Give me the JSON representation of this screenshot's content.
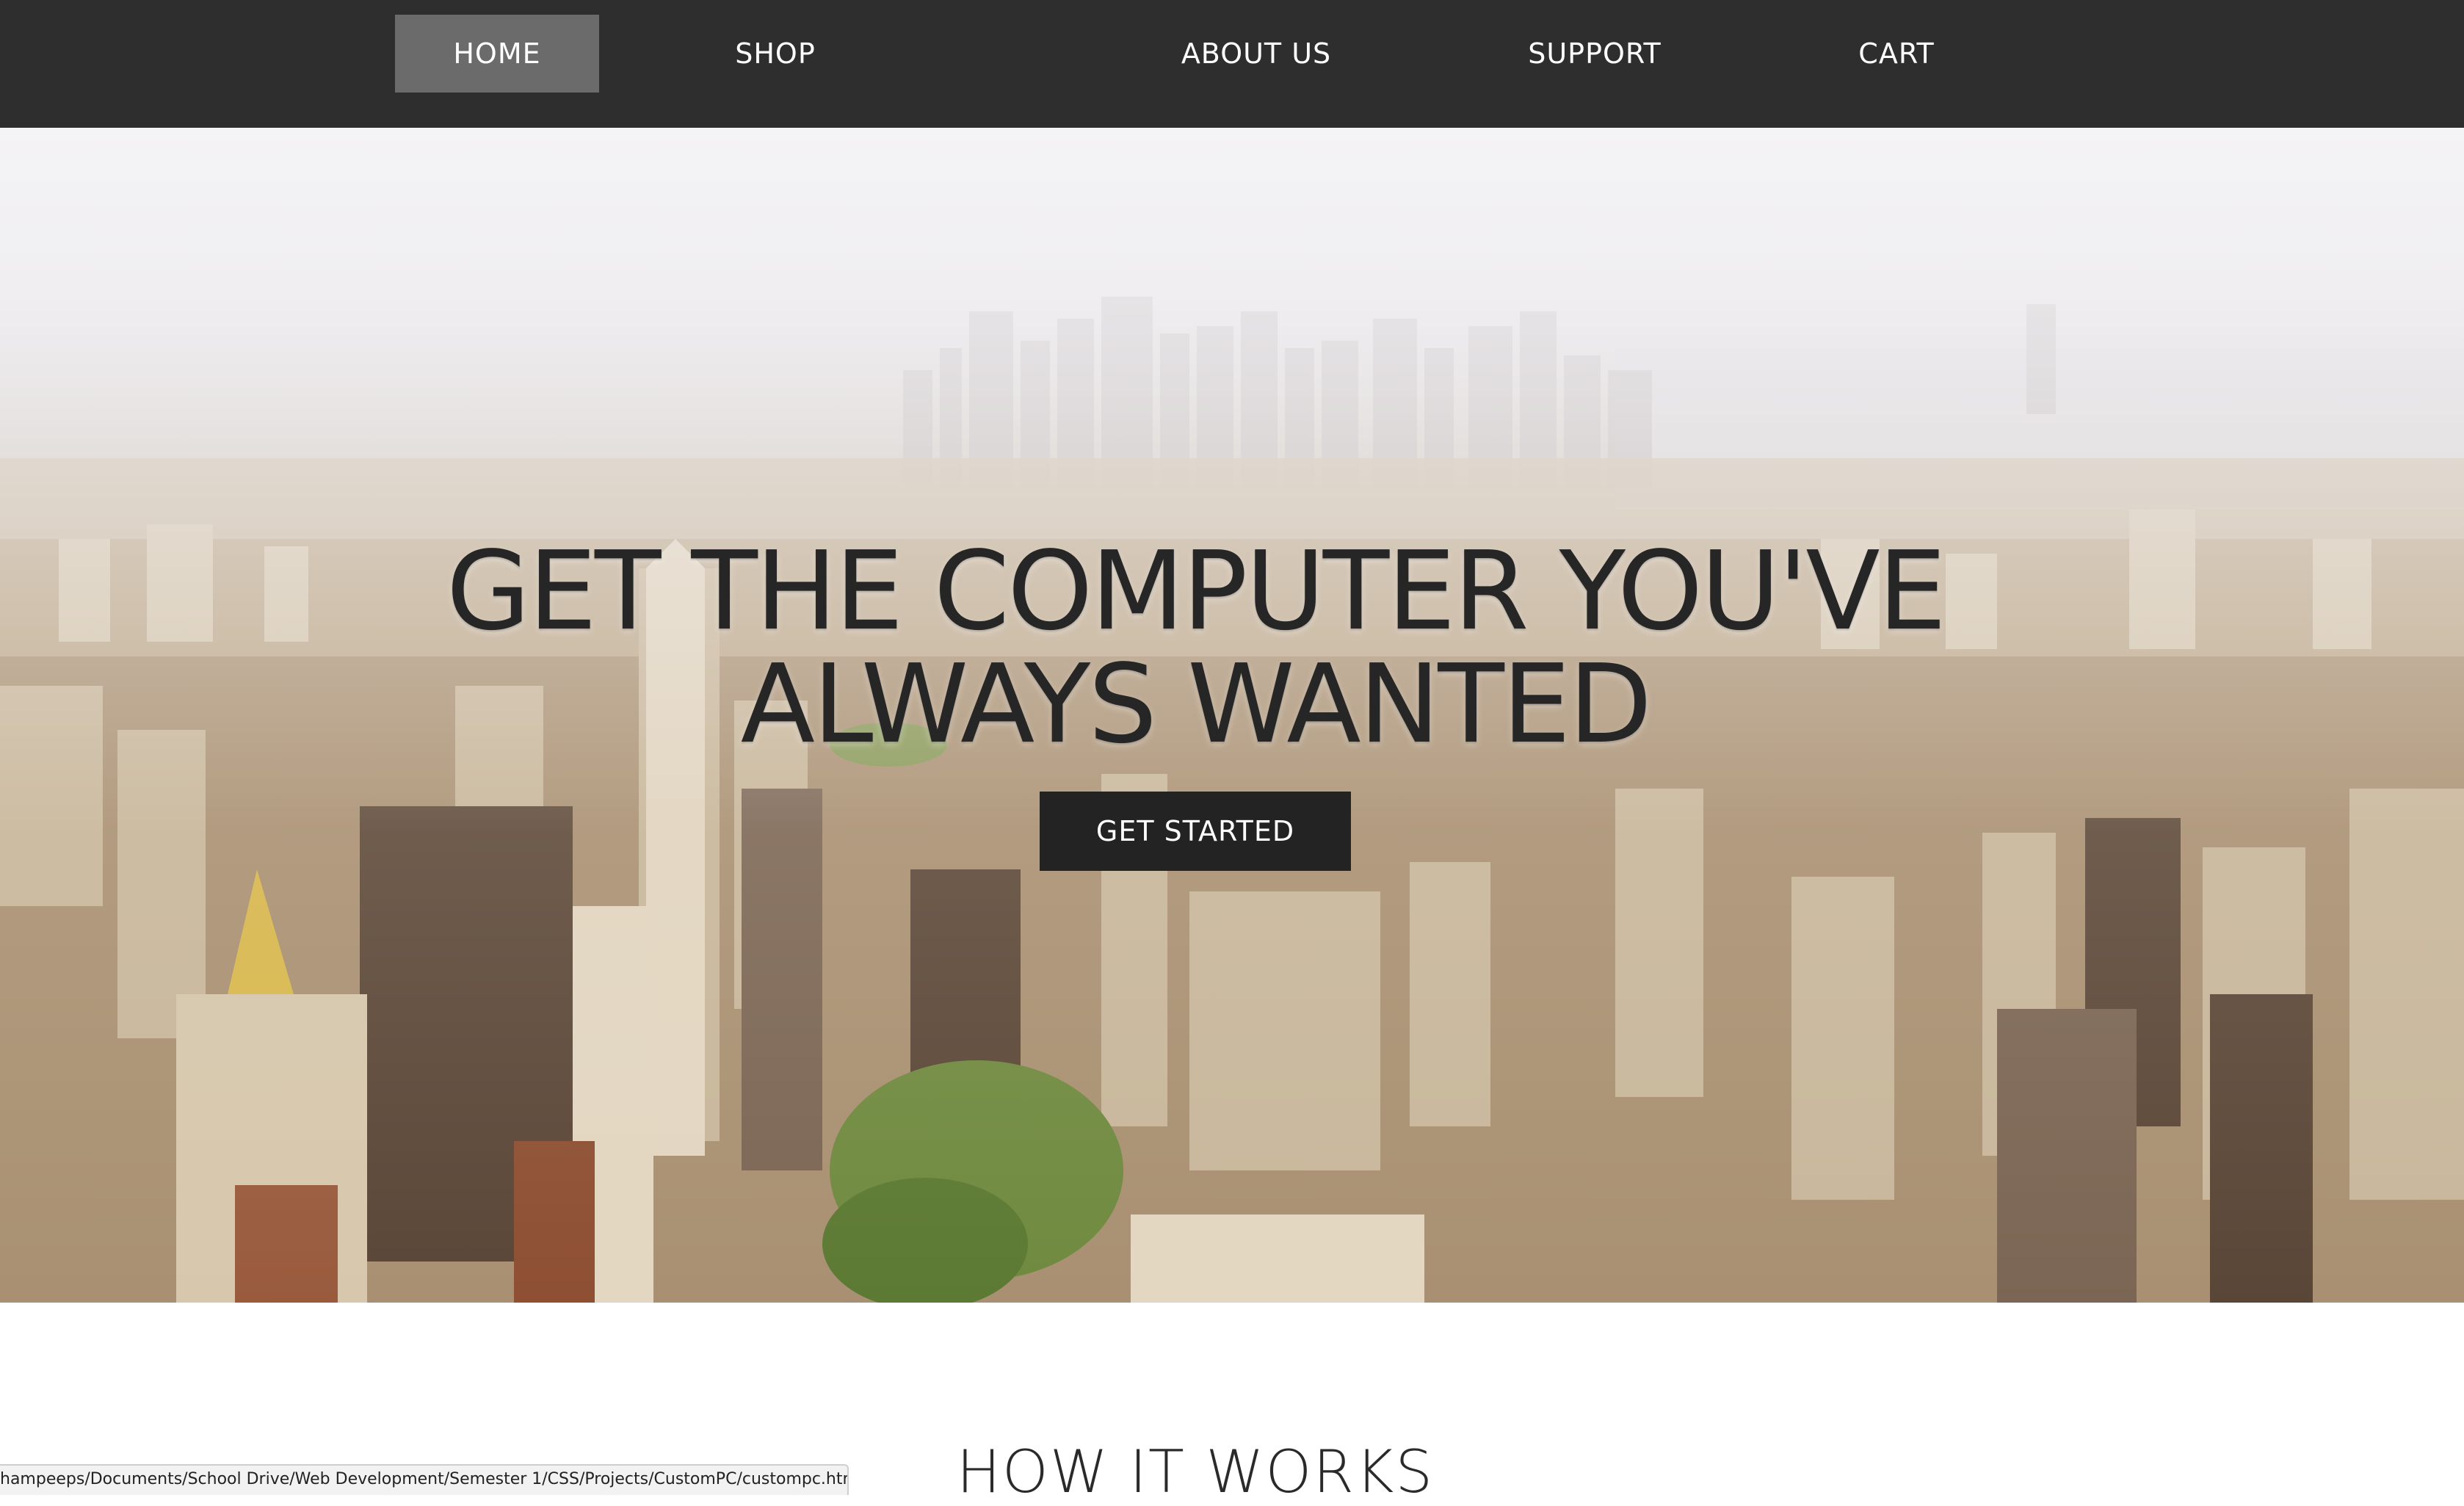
{
  "nav": {
    "items": [
      {
        "label": "HOME",
        "active": true
      },
      {
        "label": "SHOP",
        "active": false
      },
      {
        "label": "ABOUT US",
        "active": false
      },
      {
        "label": "SUPPORT",
        "active": false
      },
      {
        "label": "CART",
        "active": false
      }
    ]
  },
  "hero": {
    "title_line1": "GET THE COMPUTER YOU'VE",
    "title_line2": "ALWAYS WANTED",
    "cta_label": "GET STARTED",
    "background_image": "aerial city skyline"
  },
  "how_it_works": {
    "title": "HOW IT WORKS"
  },
  "status_bar": {
    "url": "hampeeps/Documents/School Drive/Web Development/Semester 1/CSS/Projects/CustomPC/custompc.html"
  },
  "colors": {
    "nav_bg": "#2e2e2e",
    "nav_active_bg": "#6b6b6b",
    "cta_bg": "#232323",
    "title_text": "#262626"
  }
}
